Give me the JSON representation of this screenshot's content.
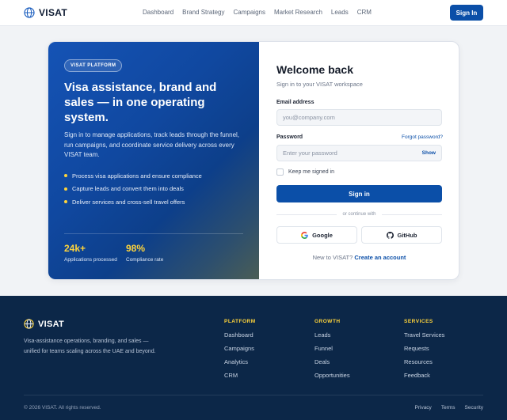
{
  "header": {
    "brand": "VISAT",
    "nav": [
      "Dashboard",
      "Brand Strategy",
      "Campaigns",
      "Market Research",
      "Leads",
      "CRM"
    ],
    "signin_label": "Sign In"
  },
  "hero": {
    "pill": "VISAT PLATFORM",
    "title": "Visa assistance, brand and sales — in one operating system.",
    "description": "Sign in to manage applications, track leads through the funnel, run campaigns, and coordinate service delivery across every VISAT team.",
    "bullets": [
      "Process visa applications and ensure compliance",
      "Capture leads and convert them into deals",
      "Deliver services and cross-sell travel offers"
    ],
    "stats": [
      {
        "value": "24k+",
        "label": "Applications processed"
      },
      {
        "value": "98%",
        "label": "Compliance rate"
      }
    ]
  },
  "form": {
    "title": "Welcome back",
    "subtitle": "Sign in to your VISAT workspace",
    "email_label": "Email address",
    "email_placeholder": "you@company.com",
    "password_label": "Password",
    "forgot": "Forgot password?",
    "password_placeholder": "Enter your password",
    "show": "Show",
    "remember": "Keep me signed in",
    "submit": "Sign in",
    "or": "or continue with",
    "google": "Google",
    "github": "GitHub",
    "new_text": "New to VISAT?",
    "create": "Create an account"
  },
  "footer": {
    "brand": "VISAT",
    "description": "Visa-assistance operations, branding, and sales — unified for teams scaling across the UAE and beyond.",
    "columns": [
      {
        "title": "PLATFORM",
        "links": [
          "Dashboard",
          "Campaigns",
          "Analytics",
          "CRM"
        ]
      },
      {
        "title": "GROWTH",
        "links": [
          "Leads",
          "Funnel",
          "Deals",
          "Opportunities"
        ]
      },
      {
        "title": "SERVICES",
        "links": [
          "Travel Services",
          "Requests",
          "Resources",
          "Feedback"
        ]
      }
    ],
    "copyright": "© 2026 VISAT. All rights reserved.",
    "legal": [
      "Privacy",
      "Terms",
      "Security"
    ]
  },
  "colors": {
    "primary": "#0b4fa8",
    "accent": "#ffd43b",
    "footer_bg": "#0c2748"
  }
}
